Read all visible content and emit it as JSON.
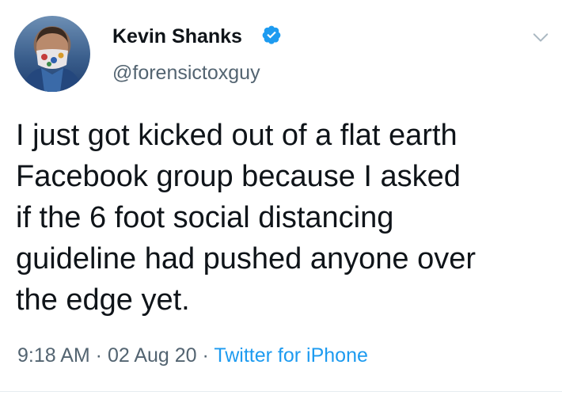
{
  "author": {
    "name": "Kevin Shanks",
    "handle": "@forensictoxguy",
    "verified": true
  },
  "tweet": {
    "lines": [
      "I just got kicked out of a flat earth",
      "Facebook group because I asked",
      "if the 6 foot social distancing",
      "guideline had pushed anyone over",
      "the edge yet."
    ],
    "time": "9:18 AM",
    "date": "02 Aug 20",
    "source": "Twitter for iPhone",
    "separator": " · "
  },
  "icons": {
    "verified": "verified-badge-icon",
    "menu": "chevron-down-icon"
  },
  "colors": {
    "accent": "#1d9bf0",
    "secondary_text": "#536471"
  }
}
